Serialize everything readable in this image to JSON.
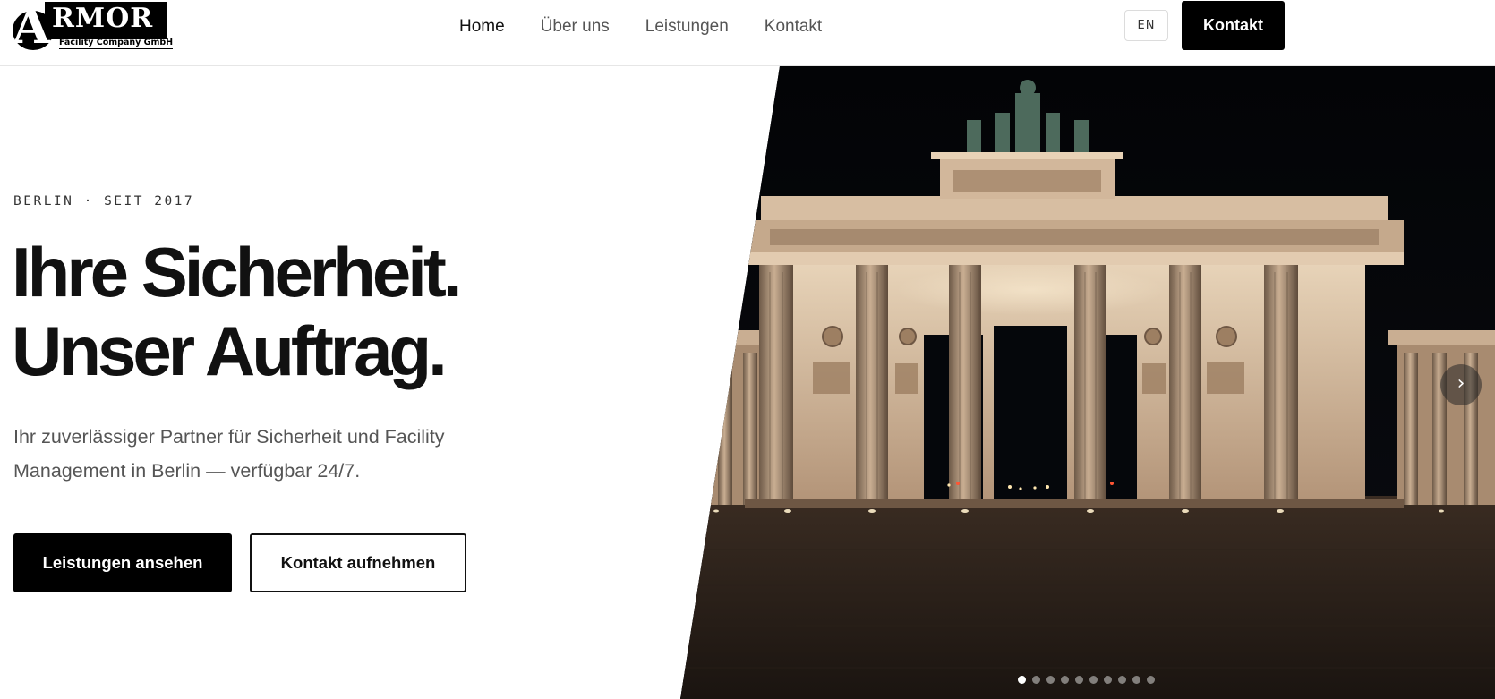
{
  "brand": {
    "logo_letter": "A",
    "logo_word": "RMOR",
    "logo_subtitle": "Facility Company GmbH"
  },
  "nav": {
    "items": [
      {
        "label": "Home",
        "active": true
      },
      {
        "label": "Über uns",
        "active": false
      },
      {
        "label": "Leistungen",
        "active": false
      },
      {
        "label": "Kontakt",
        "active": false
      }
    ]
  },
  "header": {
    "language_label": "EN",
    "cta_label": "Kontakt"
  },
  "hero": {
    "eyebrow": "BERLIN · SEIT 2017",
    "headline_line1": "Ihre Sicherheit.",
    "headline_line2": "Unser Auftrag.",
    "lead": "Ihr zuverlässiger Partner für Sicherheit und Facility Management in Berlin — verfügbar 24/7.",
    "primary_button": "Leistungen ansehen",
    "secondary_button": "Kontakt aufnehmen"
  },
  "slider": {
    "next_symbol": "›",
    "slide_count": 10,
    "active_slide": 1
  },
  "colors": {
    "text": "#111111",
    "muted": "#555555",
    "button_bg": "#000000",
    "night_sky": "#050505",
    "stone_lit": "#c9ae92"
  }
}
